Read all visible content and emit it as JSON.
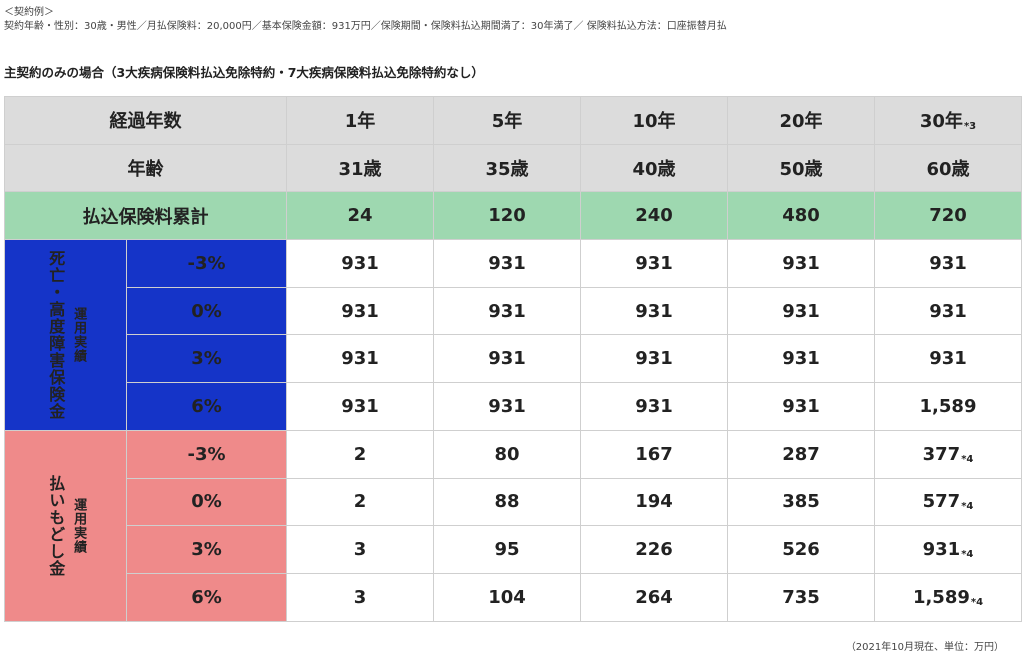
{
  "header": {
    "example_label": "＜契約例＞",
    "contract_info": "契約年齢・性別：30歳・男性／月払保険料：20,000円／基本保険金額：931万円／保険期間・保険料払込期間満了：30年満了／ 保険料払込方法：口座振替月払",
    "subtitle": "主契約のみの場合（3大疾病保険料払込免除特約・7大疾病保険料払込免除特約なし）"
  },
  "table": {
    "years_label": "経過年数",
    "age_label": "年齢",
    "premium_label": "払込保険料累計",
    "years": [
      "1年",
      "5年",
      "10年",
      "20年",
      "30年"
    ],
    "years_mark": "*3",
    "ages": [
      "31歳",
      "35歳",
      "40歳",
      "50歳",
      "60歳"
    ],
    "premium_totals": [
      "24",
      "120",
      "240",
      "480",
      "720"
    ],
    "death_group": {
      "title": "死亡・高度障害保険金",
      "sub": "運用実績",
      "rows": [
        {
          "rate": "-3%",
          "values": [
            "931",
            "931",
            "931",
            "931",
            "931"
          ]
        },
        {
          "rate": "0%",
          "values": [
            "931",
            "931",
            "931",
            "931",
            "931"
          ]
        },
        {
          "rate": "3%",
          "values": [
            "931",
            "931",
            "931",
            "931",
            "931"
          ]
        },
        {
          "rate": "6%",
          "values": [
            "931",
            "931",
            "931",
            "931",
            "1,589"
          ]
        }
      ]
    },
    "refund_group": {
      "title": "払いもどし金",
      "sub": "運用実績",
      "mark": "*4",
      "rows": [
        {
          "rate": "-3%",
          "values": [
            "2",
            "80",
            "167",
            "287",
            "377"
          ]
        },
        {
          "rate": "0%",
          "values": [
            "2",
            "88",
            "194",
            "385",
            "577"
          ]
        },
        {
          "rate": "3%",
          "values": [
            "3",
            "95",
            "226",
            "526",
            "931"
          ]
        },
        {
          "rate": "6%",
          "values": [
            "3",
            "104",
            "264",
            "735",
            "1,589"
          ]
        }
      ]
    }
  },
  "footer": {
    "note": "（2021年10月現在、単位：万円）"
  },
  "colors": {
    "header_gray": "#dcdcdc",
    "premium_green": "#9ed8b0",
    "death_blue": "#1534c8",
    "refund_pink": "#ef8a8a",
    "value_blue": "#2f49b4"
  }
}
